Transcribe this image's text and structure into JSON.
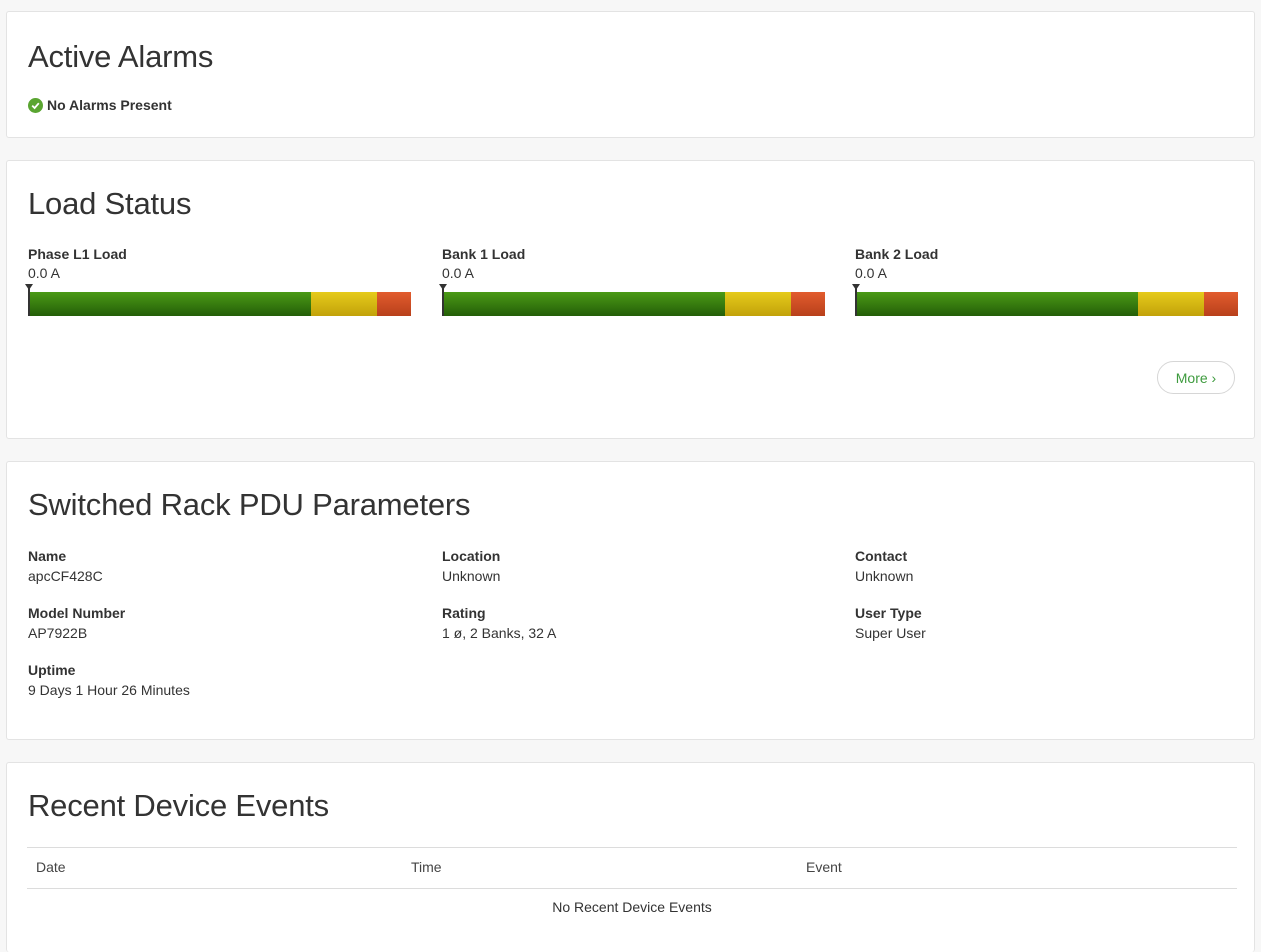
{
  "alarms": {
    "title": "Active Alarms",
    "status": "No Alarms Present",
    "status_color": "#5aa531"
  },
  "load": {
    "title": "Load Status",
    "meters": [
      {
        "label": "Phase  L1 Load",
        "value": "0.0 A",
        "level": 0
      },
      {
        "label": "Bank  1 Load",
        "value": "0.0 A",
        "level": 0
      },
      {
        "label": "Bank  2 Load",
        "value": "0.0 A",
        "level": 0
      }
    ],
    "colors": {
      "normal": "#3f8a12",
      "warning": "#d9bb12",
      "overload": "#d04f24"
    },
    "more_label": "More ›"
  },
  "params": {
    "title": "Switched Rack PDU Parameters",
    "fields": [
      {
        "label": "Name",
        "value": "apcCF428C"
      },
      {
        "label": "Location",
        "value": "Unknown"
      },
      {
        "label": "Contact",
        "value": "Unknown"
      },
      {
        "label": "Model Number",
        "value": "AP7922B"
      },
      {
        "label": "Rating",
        "value": "1 ø, 2 Banks, 32 A"
      },
      {
        "label": "User Type",
        "value": "Super User"
      },
      {
        "label": "Uptime",
        "value": "9 Days 1 Hour 26 Minutes"
      }
    ]
  },
  "events": {
    "title": "Recent Device Events",
    "columns": [
      "Date",
      "Time",
      "Event"
    ],
    "empty_message": "No Recent Device Events"
  }
}
